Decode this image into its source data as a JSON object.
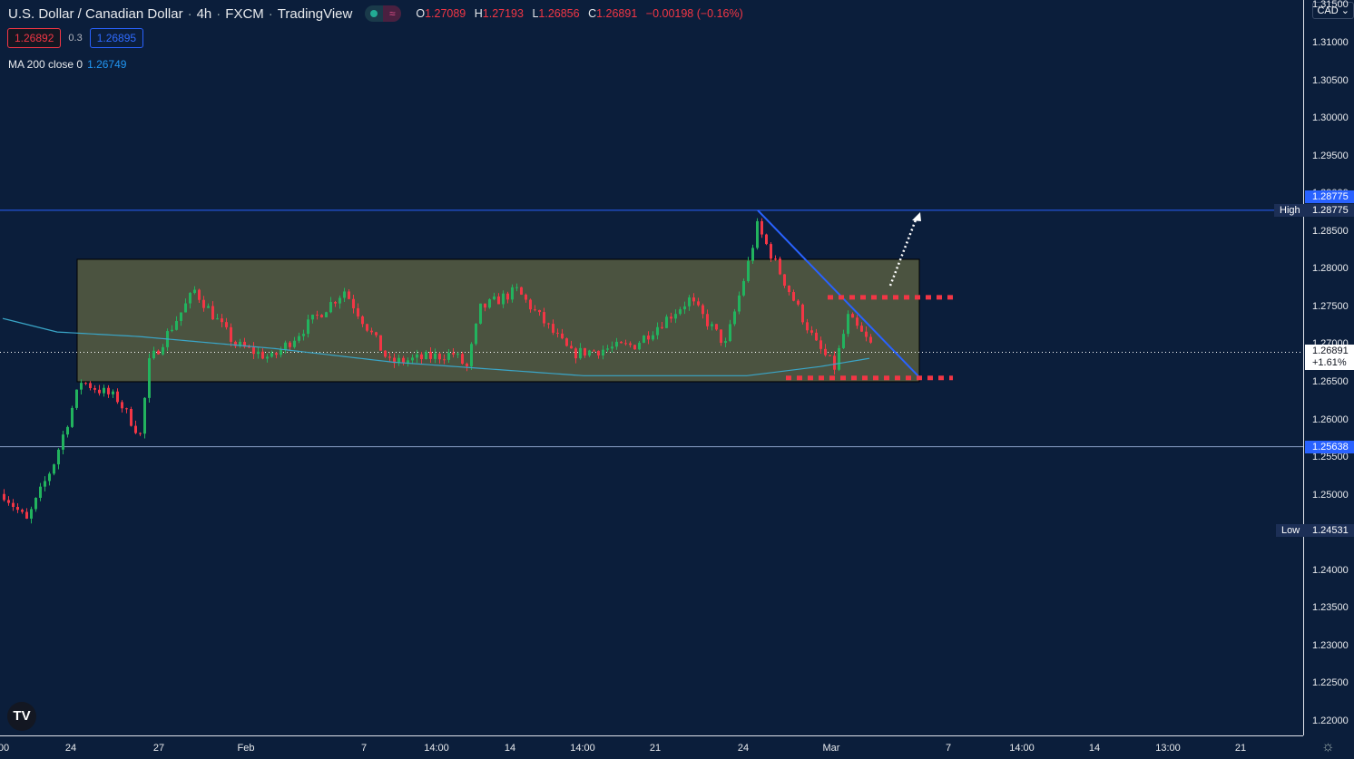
{
  "header": {
    "title": "U.S. Dollar / Canadian Dollar",
    "interval": "4h",
    "source": "FXCM",
    "platform": "TradingView",
    "sep": "·",
    "ohlc": {
      "o_label": "O",
      "o": "1.27089",
      "h_label": "H",
      "h": "1.27193",
      "l_label": "L",
      "l": "1.26856",
      "c_label": "C",
      "c": "1.26891",
      "change": "−0.00198 (−0.16%)"
    },
    "status_wave": "≈"
  },
  "quote": {
    "sell": "1.26892",
    "spread": "0.3",
    "buy": "1.26895"
  },
  "indicator": {
    "label": "MA 200 close 0",
    "value": "1.26749"
  },
  "price_axis": {
    "currency": "CAD",
    "ticks": [
      "1.31500",
      "1.31000",
      "1.30500",
      "1.30000",
      "1.29500",
      "1.29000",
      "1.28500",
      "1.28000",
      "1.27500",
      "1.27000",
      "1.26500",
      "1.26000",
      "1.25500",
      "1.25000",
      "1.24500",
      "1.24000",
      "1.23500",
      "1.23000",
      "1.22500",
      "1.22000"
    ],
    "high_label": "High",
    "high": "1.28775",
    "high_line": "1.28775",
    "current": "1.26891",
    "current_change": "+1.61%",
    "support_line": "1.25638",
    "low_label": "Low",
    "low": "1.24531"
  },
  "time_axis": [
    "00",
    "24",
    "27",
    "Feb",
    "7",
    "14:00",
    "14",
    "14:00",
    "21",
    "24",
    "Mar",
    "7",
    "14:00",
    "14",
    "13:00",
    "21"
  ],
  "colors": {
    "up": "#22b35e",
    "down": "#f23645",
    "ma": "#3aa6c8",
    "trend": "#2962ff",
    "box": "#4b5340",
    "bg": "#0b1e3b"
  },
  "chart_data": {
    "type": "candlestick",
    "price_range": [
      1.2175,
      1.3155
    ],
    "close_waypoints": [
      [
        0,
        1.2501
      ],
      [
        5,
        1.2465
      ],
      [
        11,
        1.2543
      ],
      [
        17,
        1.2651
      ],
      [
        25,
        1.2627
      ],
      [
        30,
        1.2579
      ],
      [
        32,
        1.2675
      ],
      [
        42,
        1.2771
      ],
      [
        51,
        1.2699
      ],
      [
        59,
        1.2681
      ],
      [
        75,
        1.2771
      ],
      [
        85,
        1.2675
      ],
      [
        99,
        1.2687
      ],
      [
        102,
        1.2669
      ],
      [
        105,
        1.2747
      ],
      [
        113,
        1.2771
      ],
      [
        125,
        1.2687
      ],
      [
        139,
        1.2699
      ],
      [
        151,
        1.2759
      ],
      [
        159,
        1.2699
      ],
      [
        164,
        1.2807
      ],
      [
        166,
        1.2856
      ],
      [
        171,
        1.2795
      ],
      [
        179,
        1.2699
      ],
      [
        183,
        1.2669
      ],
      [
        186,
        1.2735
      ],
      [
        191,
        1.2699
      ]
    ],
    "ma_waypoints": [
      [
        0,
        1.2734
      ],
      [
        12,
        1.2716
      ],
      [
        30,
        1.271
      ],
      [
        60,
        1.2694
      ],
      [
        86,
        1.2676
      ],
      [
        128,
        1.2658
      ],
      [
        164,
        1.2658
      ],
      [
        180,
        1.267
      ],
      [
        191,
        1.2681
      ]
    ],
    "range_box": [
      1.265,
      1.28124
    ],
    "resistance": 1.2762,
    "support": 1.2655
  }
}
